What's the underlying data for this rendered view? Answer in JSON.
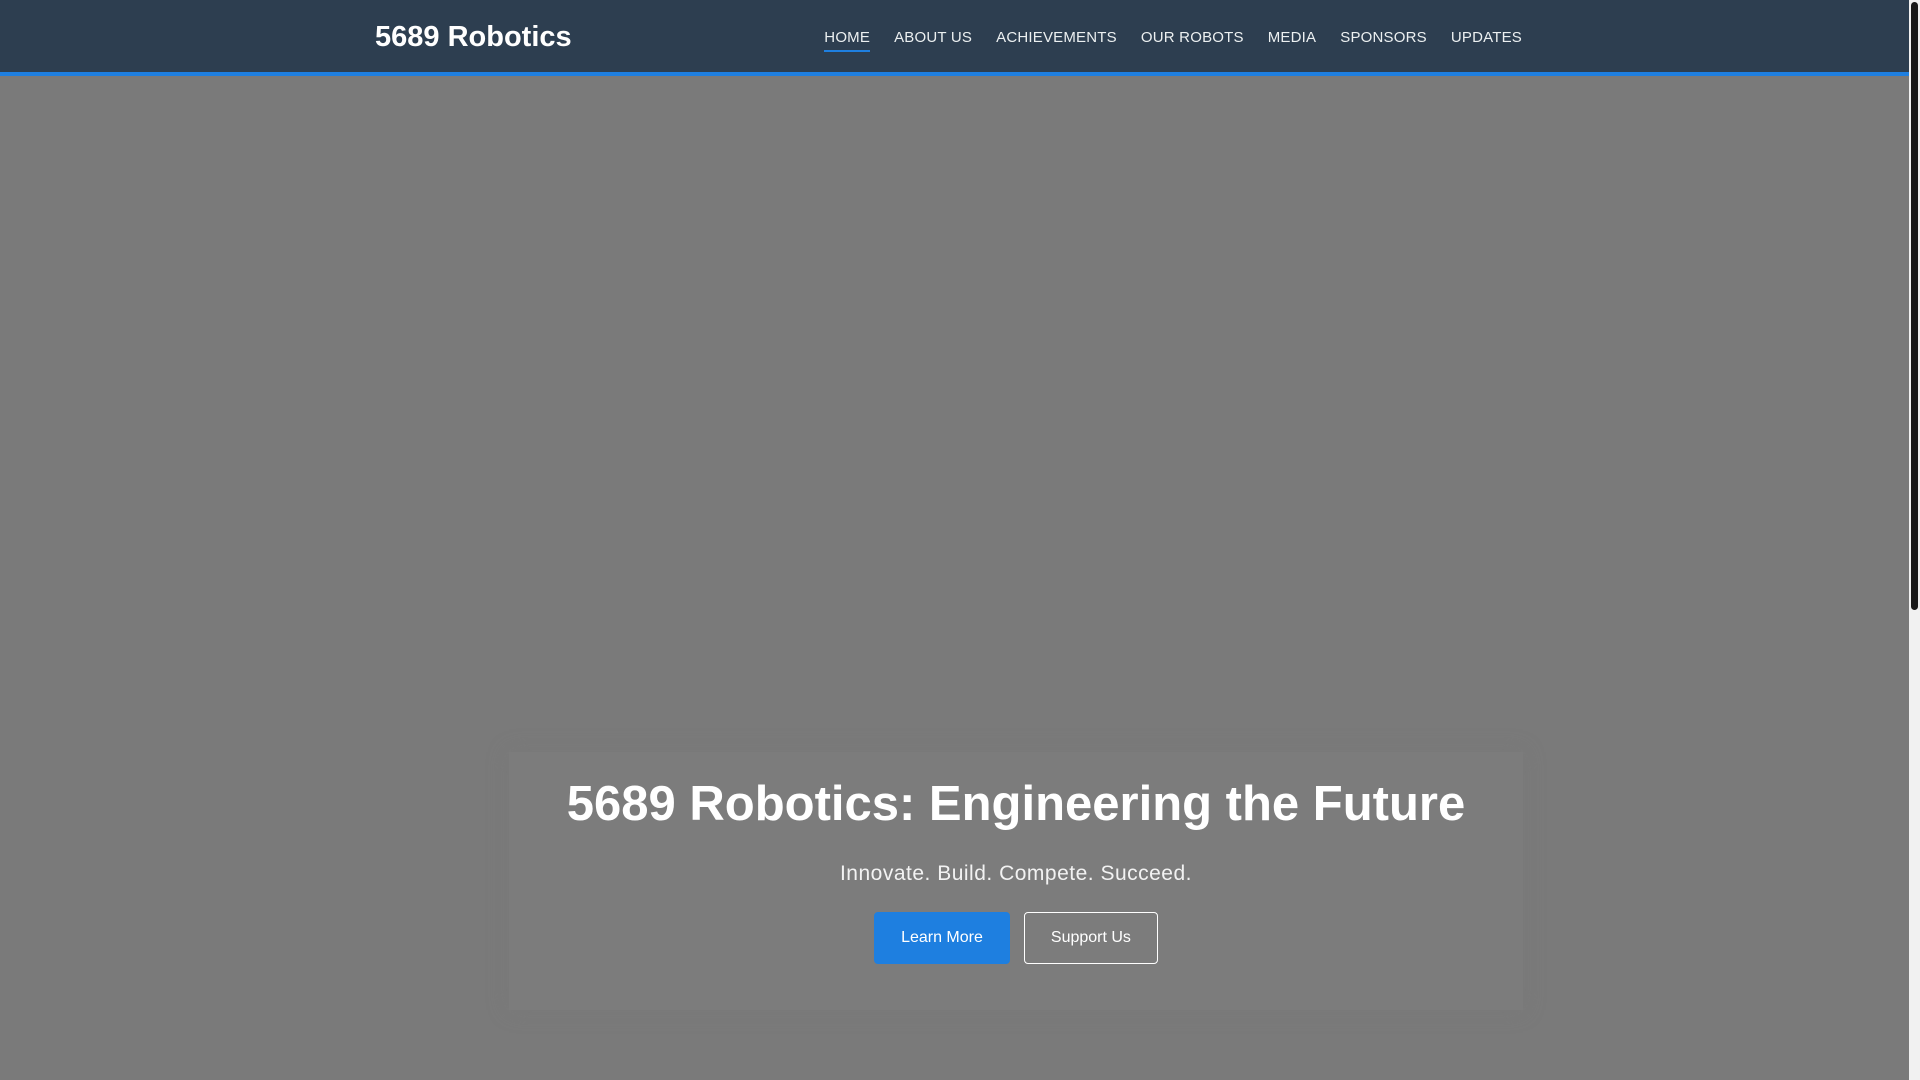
{
  "header": {
    "brand": "5689 Robotics",
    "nav": [
      {
        "label": "HOME",
        "active": true
      },
      {
        "label": "ABOUT US"
      },
      {
        "label": "ACHIEVEMENTS"
      },
      {
        "label": "OUR ROBOTS"
      },
      {
        "label": "MEDIA"
      },
      {
        "label": "SPONSORS"
      },
      {
        "label": "UPDATES"
      }
    ]
  },
  "hero": {
    "title": "5689 Robotics: Engineering the Future",
    "subtitle": "Innovate. Build. Compete. Succeed.",
    "primary_button": "Learn More",
    "secondary_button": "Support Us"
  },
  "colors": {
    "navbar": "#2d3e50",
    "accent": "#1e7fe0",
    "hero_background": "#7a7a7a"
  }
}
